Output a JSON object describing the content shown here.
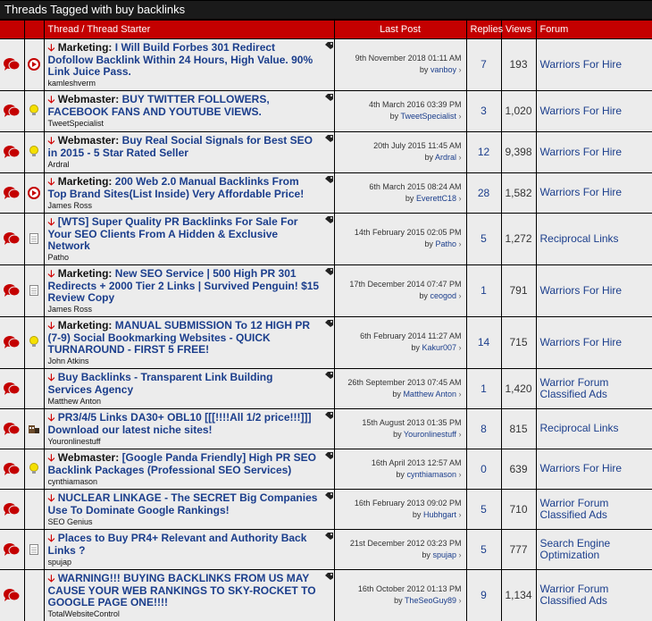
{
  "header": {
    "title_prefix": "Threads Tagged with",
    "tag": "buy backlinks"
  },
  "columns": {
    "thread": "Thread / Thread Starter",
    "last_post": "Last Post",
    "replies": "Replies",
    "views": "Views",
    "forum": "Forum"
  },
  "colors": {
    "header_red": "#c40000",
    "link_blue": "#1b3e8c",
    "row_bg": "#ececec"
  },
  "threads": [
    {
      "status_icon": "thread-hot-red-icon",
      "type_icon": "play-circle-icon",
      "prefix": "Marketing:",
      "title": "I Will Build Forbes 301 Redirect Dofollow Backlink Within 24 Hours, High Value. 90% Link Juice Pass.",
      "starter": "kamleshverm",
      "last_date": "9th November 2018 01:11 AM",
      "last_by": "vanboy",
      "by_label": "by",
      "replies": "7",
      "views": "193",
      "forum": "Warriors For Hire",
      "height": 46
    },
    {
      "status_icon": "thread-red-icon",
      "type_icon": "lightbulb-icon",
      "prefix": "Webmaster:",
      "title": "BUY TWITTER FOLLOWERS, FACEBOOK FANS AND YOUTUBE VIEWS.",
      "starter": "TweetSpecialist",
      "last_date": "4th March 2016 03:39 PM",
      "last_by": "TweetSpecialist",
      "by_label": "by",
      "replies": "3",
      "views": "1,020",
      "forum": "Warriors For Hire",
      "height": 46
    },
    {
      "status_icon": "thread-red-icon",
      "type_icon": "lightbulb-icon",
      "prefix": "Webmaster:",
      "title": "Buy Real Social Signals for Best SEO in 2015 - 5 Star Rated Seller",
      "starter": "Ardral",
      "last_date": "20th July 2015 11:45 AM",
      "last_by": "Ardral",
      "by_label": "by",
      "replies": "12",
      "views": "9,398",
      "forum": "Warriors For Hire",
      "height": 46
    },
    {
      "status_icon": "thread-red-icon",
      "type_icon": "play-circle-icon",
      "prefix": "Marketing:",
      "title": "200 Web 2.0 Manual Backlinks From Top Brand Sites(List Inside) Very Affordable Price!",
      "starter": "James Ross",
      "last_date": "6th March 2015 08:24 AM",
      "last_by": "EverettC18",
      "by_label": "by",
      "replies": "28",
      "views": "1,582",
      "forum": "Warriors For Hire",
      "height": 45
    },
    {
      "status_icon": "thread-red-icon",
      "type_icon": "document-icon",
      "prefix": "",
      "title": "[WTS] Super Quality PR Backlinks For Sale For Your SEO Clients From A Hidden & Exclusive Network",
      "starter": "Patho",
      "last_date": "14th February 2015 02:05 PM",
      "last_by": "Patho",
      "by_label": "by",
      "replies": "5",
      "views": "1,272",
      "forum": "Reciprocal Links",
      "height": 46
    },
    {
      "status_icon": "thread-red-icon",
      "type_icon": "document-icon",
      "prefix": "Marketing:",
      "title": "New SEO Service | 500 High PR 301 Redirects + 2000 Tier 2 Links | Survived Penguin! $15 Review Copy",
      "starter": "James Ross",
      "last_date": "17th December 2014 07:47 PM",
      "last_by": "ceogod",
      "by_label": "by",
      "replies": "1",
      "views": "791",
      "forum": "Warriors For Hire",
      "height": 58
    },
    {
      "status_icon": "thread-red-icon",
      "type_icon": "lightbulb-icon",
      "prefix": "Marketing:",
      "title": "MANUAL SUBMISSION To 12 HIGH PR (7-9) Social Bookmarking Websites - QUICK TURNAROUND - FIRST 5 FREE!",
      "starter": "John Atkins",
      "last_date": "6th February 2014 11:27 AM",
      "last_by": "Kakur007",
      "by_label": "by",
      "replies": "14",
      "views": "715",
      "forum": "Warriors For Hire",
      "height": 58
    },
    {
      "status_icon": "thread-red-icon",
      "type_icon": "",
      "prefix": "",
      "title": "Buy Backlinks - Transparent Link Building Services Agency",
      "starter": "Matthew Anton",
      "last_date": "26th September 2013 07:45 AM",
      "last_by": "Matthew Anton",
      "by_label": "by",
      "replies": "1",
      "views": "1,420",
      "forum": "Warrior Forum Classified Ads",
      "height": 45
    },
    {
      "status_icon": "thread-red-icon",
      "type_icon": "trophy-icon",
      "prefix": "",
      "title": "PR3/4/5 Links DA30+ OBL10 [[[!!!!All 1/2 price!!!]]] Download our latest niche sites!",
      "starter": "Youronlinestuff",
      "last_date": "15th August 2013 01:35 PM",
      "last_by": "Youronlinestuff",
      "by_label": "by",
      "replies": "8",
      "views": "815",
      "forum": "Reciprocal Links",
      "height": 45
    },
    {
      "status_icon": "thread-red-icon",
      "type_icon": "lightbulb-icon",
      "prefix": "Webmaster:",
      "title": "[Google Panda Friendly] High PR SEO Backlink Packages (Professional SEO Services)",
      "starter": "cynthiamason",
      "last_date": "16th April 2013 12:57 AM",
      "last_by": "cynthiamason",
      "by_label": "by",
      "replies": "0",
      "views": "639",
      "forum": "Warriors For Hire",
      "height": 45
    },
    {
      "status_icon": "thread-red-icon",
      "type_icon": "",
      "prefix": "",
      "title": "NUCLEAR LINKAGE - The SECRET Big Companies Use To Dominate Google Rankings!",
      "starter": "SEO Genius",
      "last_date": "16th February 2013 09:02 PM",
      "last_by": "Hubhgart",
      "by_label": "by",
      "replies": "5",
      "views": "710",
      "forum": "Warrior Forum Classified Ads",
      "height": 45
    },
    {
      "status_icon": "thread-red-icon",
      "type_icon": "document-icon",
      "prefix": "",
      "title": "Places to Buy PR4+ Relevant and Authority Back Links ?",
      "starter": "spujap",
      "last_date": "21st December 2012 03:23 PM",
      "last_by": "spujap",
      "by_label": "by",
      "replies": "5",
      "views": "777",
      "forum": "Search Engine Optimization",
      "height": 45
    },
    {
      "status_icon": "thread-red-icon",
      "type_icon": "",
      "prefix": "",
      "title": "WARNING!!! BUYING BACKLINKS FROM US MAY CAUSE YOUR WEB RANKINGS TO SKY-ROCKET TO GOOGLE PAGE ONE!!!!",
      "starter": "TotalWebsiteControl",
      "last_date": "16th October 2012 01:13 PM",
      "last_by": "TheSeoGuy89",
      "by_label": "by",
      "replies": "9",
      "views": "1,134",
      "forum": "Warrior Forum Classified Ads",
      "height": 58
    }
  ]
}
